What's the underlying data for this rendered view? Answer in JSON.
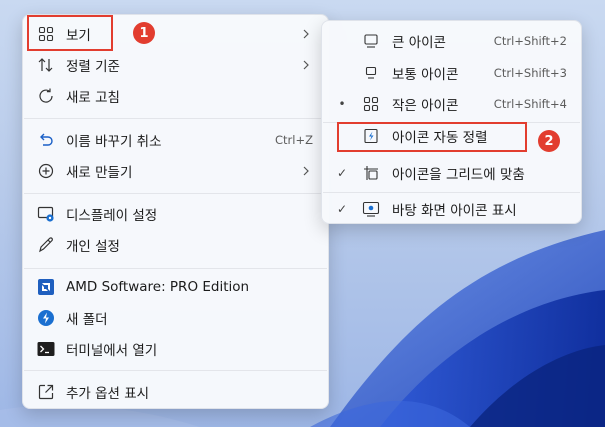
{
  "colors": {
    "annotation": "#e23d2f",
    "menu_bg": "#f7f9fc",
    "text": "#1b1b1b",
    "shortcut": "#5c5c5c",
    "amd_logo": "#1f5fbf",
    "folder_icon": "#1a6fd0",
    "terminal_icon": "#1e1e1e"
  },
  "main_menu": {
    "items": [
      {
        "label": "보기",
        "icon": "grid-icon",
        "submenu": true
      },
      {
        "label": "정렬 기준",
        "icon": "sort-icon",
        "submenu": true
      },
      {
        "label": "새로 고침",
        "icon": "refresh-icon"
      },
      {
        "label": "이름 바꾸기 취소",
        "icon": "undo-icon",
        "shortcut": "Ctrl+Z"
      },
      {
        "label": "새로 만들기",
        "icon": "plus-circle-icon",
        "submenu": true
      },
      {
        "label": "디스플레이 설정",
        "icon": "display-settings-icon"
      },
      {
        "label": "개인 설정",
        "icon": "pen-icon"
      },
      {
        "label": "AMD Software: PRO Edition",
        "icon": "amd-logo-icon"
      },
      {
        "label": "새 폴더",
        "icon": "folder-app-icon"
      },
      {
        "label": "터미널에서 열기",
        "icon": "terminal-icon"
      },
      {
        "label": "추가 옵션 표시",
        "icon": "external-open-icon"
      }
    ]
  },
  "view_submenu": {
    "items": [
      {
        "label": "큰 아이콘",
        "icon": "large-icons-icon",
        "shortcut": "Ctrl+Shift+2",
        "mark": ""
      },
      {
        "label": "보통 아이콘",
        "icon": "medium-icons-icon",
        "shortcut": "Ctrl+Shift+3",
        "mark": ""
      },
      {
        "label": "작은 아이콘",
        "icon": "small-icons-icon",
        "shortcut": "Ctrl+Shift+4",
        "mark": "•"
      },
      {
        "label": "아이콘 자동 정렬",
        "icon": "auto-arrange-icon",
        "mark": ""
      },
      {
        "label": "아이콘을 그리드에 맞춤",
        "icon": "align-grid-icon",
        "mark": "✓"
      },
      {
        "label": "바탕 화면 아이콘 표시",
        "icon": "show-desktop-icons-icon",
        "mark": "✓"
      }
    ]
  },
  "annotations": {
    "badge_1": "1",
    "badge_2": "2"
  }
}
